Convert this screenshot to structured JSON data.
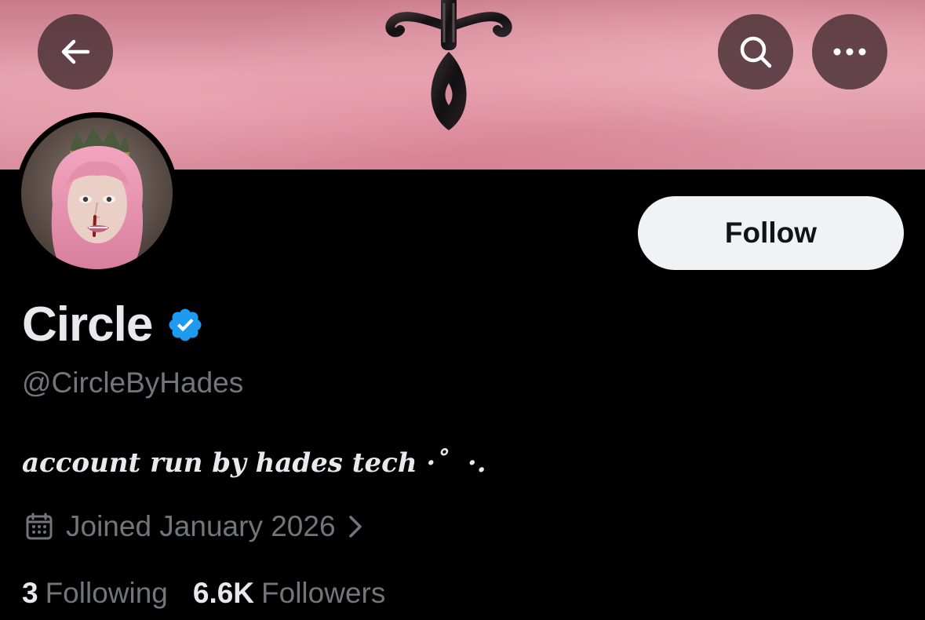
{
  "header": {
    "back_icon": "arrow-left-icon",
    "search_icon": "search-icon",
    "more_icon": "more-horizontal-icon"
  },
  "profile": {
    "display_name": "Circle",
    "verified": true,
    "verified_icon": "verified-badge-icon",
    "verified_color": "#1d9bf0",
    "handle": "@CircleByHades",
    "bio": "account run by hades tech ·˚  ·.",
    "joined": "Joined January 2026",
    "joined_icon": "calendar-icon",
    "joined_chevron_icon": "chevron-right-icon"
  },
  "actions": {
    "follow_label": "Follow"
  },
  "stats": {
    "following_count": "3",
    "following_label": "Following",
    "followers_count": "6.6K",
    "followers_label": "Followers"
  },
  "colors": {
    "background": "#000000",
    "primary_text": "#e7e9ea",
    "secondary_text": "#71767b",
    "follow_button_bg": "#eff3f4",
    "banner_pink": "#dc95a4"
  }
}
